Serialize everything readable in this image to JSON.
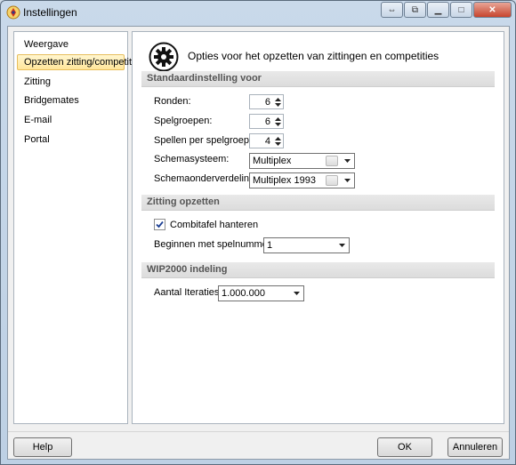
{
  "window": {
    "title": "Instellingen",
    "icon": "suit-logo-icon"
  },
  "sidebar": {
    "items": [
      {
        "label": "Weergave",
        "selected": false
      },
      {
        "label": "Opzetten zitting/competitie",
        "selected": true
      },
      {
        "label": "Zitting",
        "selected": false
      },
      {
        "label": "Bridgemates",
        "selected": false
      },
      {
        "label": "E-mail",
        "selected": false
      },
      {
        "label": "Portal",
        "selected": false
      }
    ]
  },
  "header": {
    "icon": "gear-icon",
    "text": "Opties voor het opzetten van zittingen en competities"
  },
  "sections": {
    "standaard": {
      "title": "Standaardinstelling voor",
      "rounds_label": "Ronden:",
      "rounds_value": "6",
      "groups_label": "Spelgroepen:",
      "groups_value": "6",
      "games_label": "Spellen per spelgroep:",
      "games_value": "4",
      "scheme_label": "Schemasysteem:",
      "scheme_value": "Multiplex",
      "subdiv_label": "Schemaonderverdeling:",
      "subdiv_value": "Multiplex 1993"
    },
    "zitting": {
      "title": "Zitting opzetten",
      "combi_label": "Combitafel hanteren",
      "combi_checked": true,
      "start_label": "Beginnen met spelnummer:",
      "start_value": "1"
    },
    "wip": {
      "title": "WIP2000 indeling",
      "iter_label": "Aantal Iteraties:",
      "iter_value": "1.000.000"
    }
  },
  "footer": {
    "help": "Help",
    "ok": "OK",
    "cancel": "Annuleren"
  }
}
